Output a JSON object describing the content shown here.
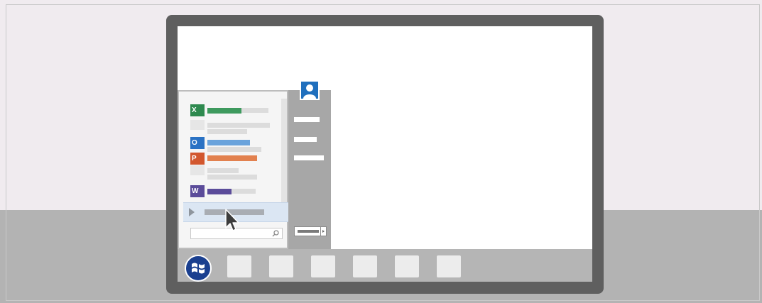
{
  "scene": {
    "wall_color": "#f0ebef",
    "desk_color": "#b3b3b3",
    "monitor_bezel_color": "#5f5f5f"
  },
  "taskbar": {
    "start_button_icon": "windows-logo-icon",
    "pinned_buttons": 6
  },
  "start_menu": {
    "pinned_apps": [
      {
        "icon": "excel-icon",
        "letter": "X",
        "color": "#2e8a4f"
      },
      {
        "icon": "outlook-icon",
        "letter": "O",
        "color": "#2a72c4"
      },
      {
        "icon": "powerpoint-icon",
        "letter": "P",
        "color": "#d2572e"
      },
      {
        "icon": "word-icon",
        "letter": "W",
        "color": "#5b4c9a"
      }
    ],
    "all_programs_highlight_color": "#dbe6f3",
    "search_icon": "search-icon",
    "user_icon": "user-avatar-icon",
    "power_icon": "shutdown-button"
  },
  "cursor": {
    "icon": "mouse-pointer-icon"
  }
}
